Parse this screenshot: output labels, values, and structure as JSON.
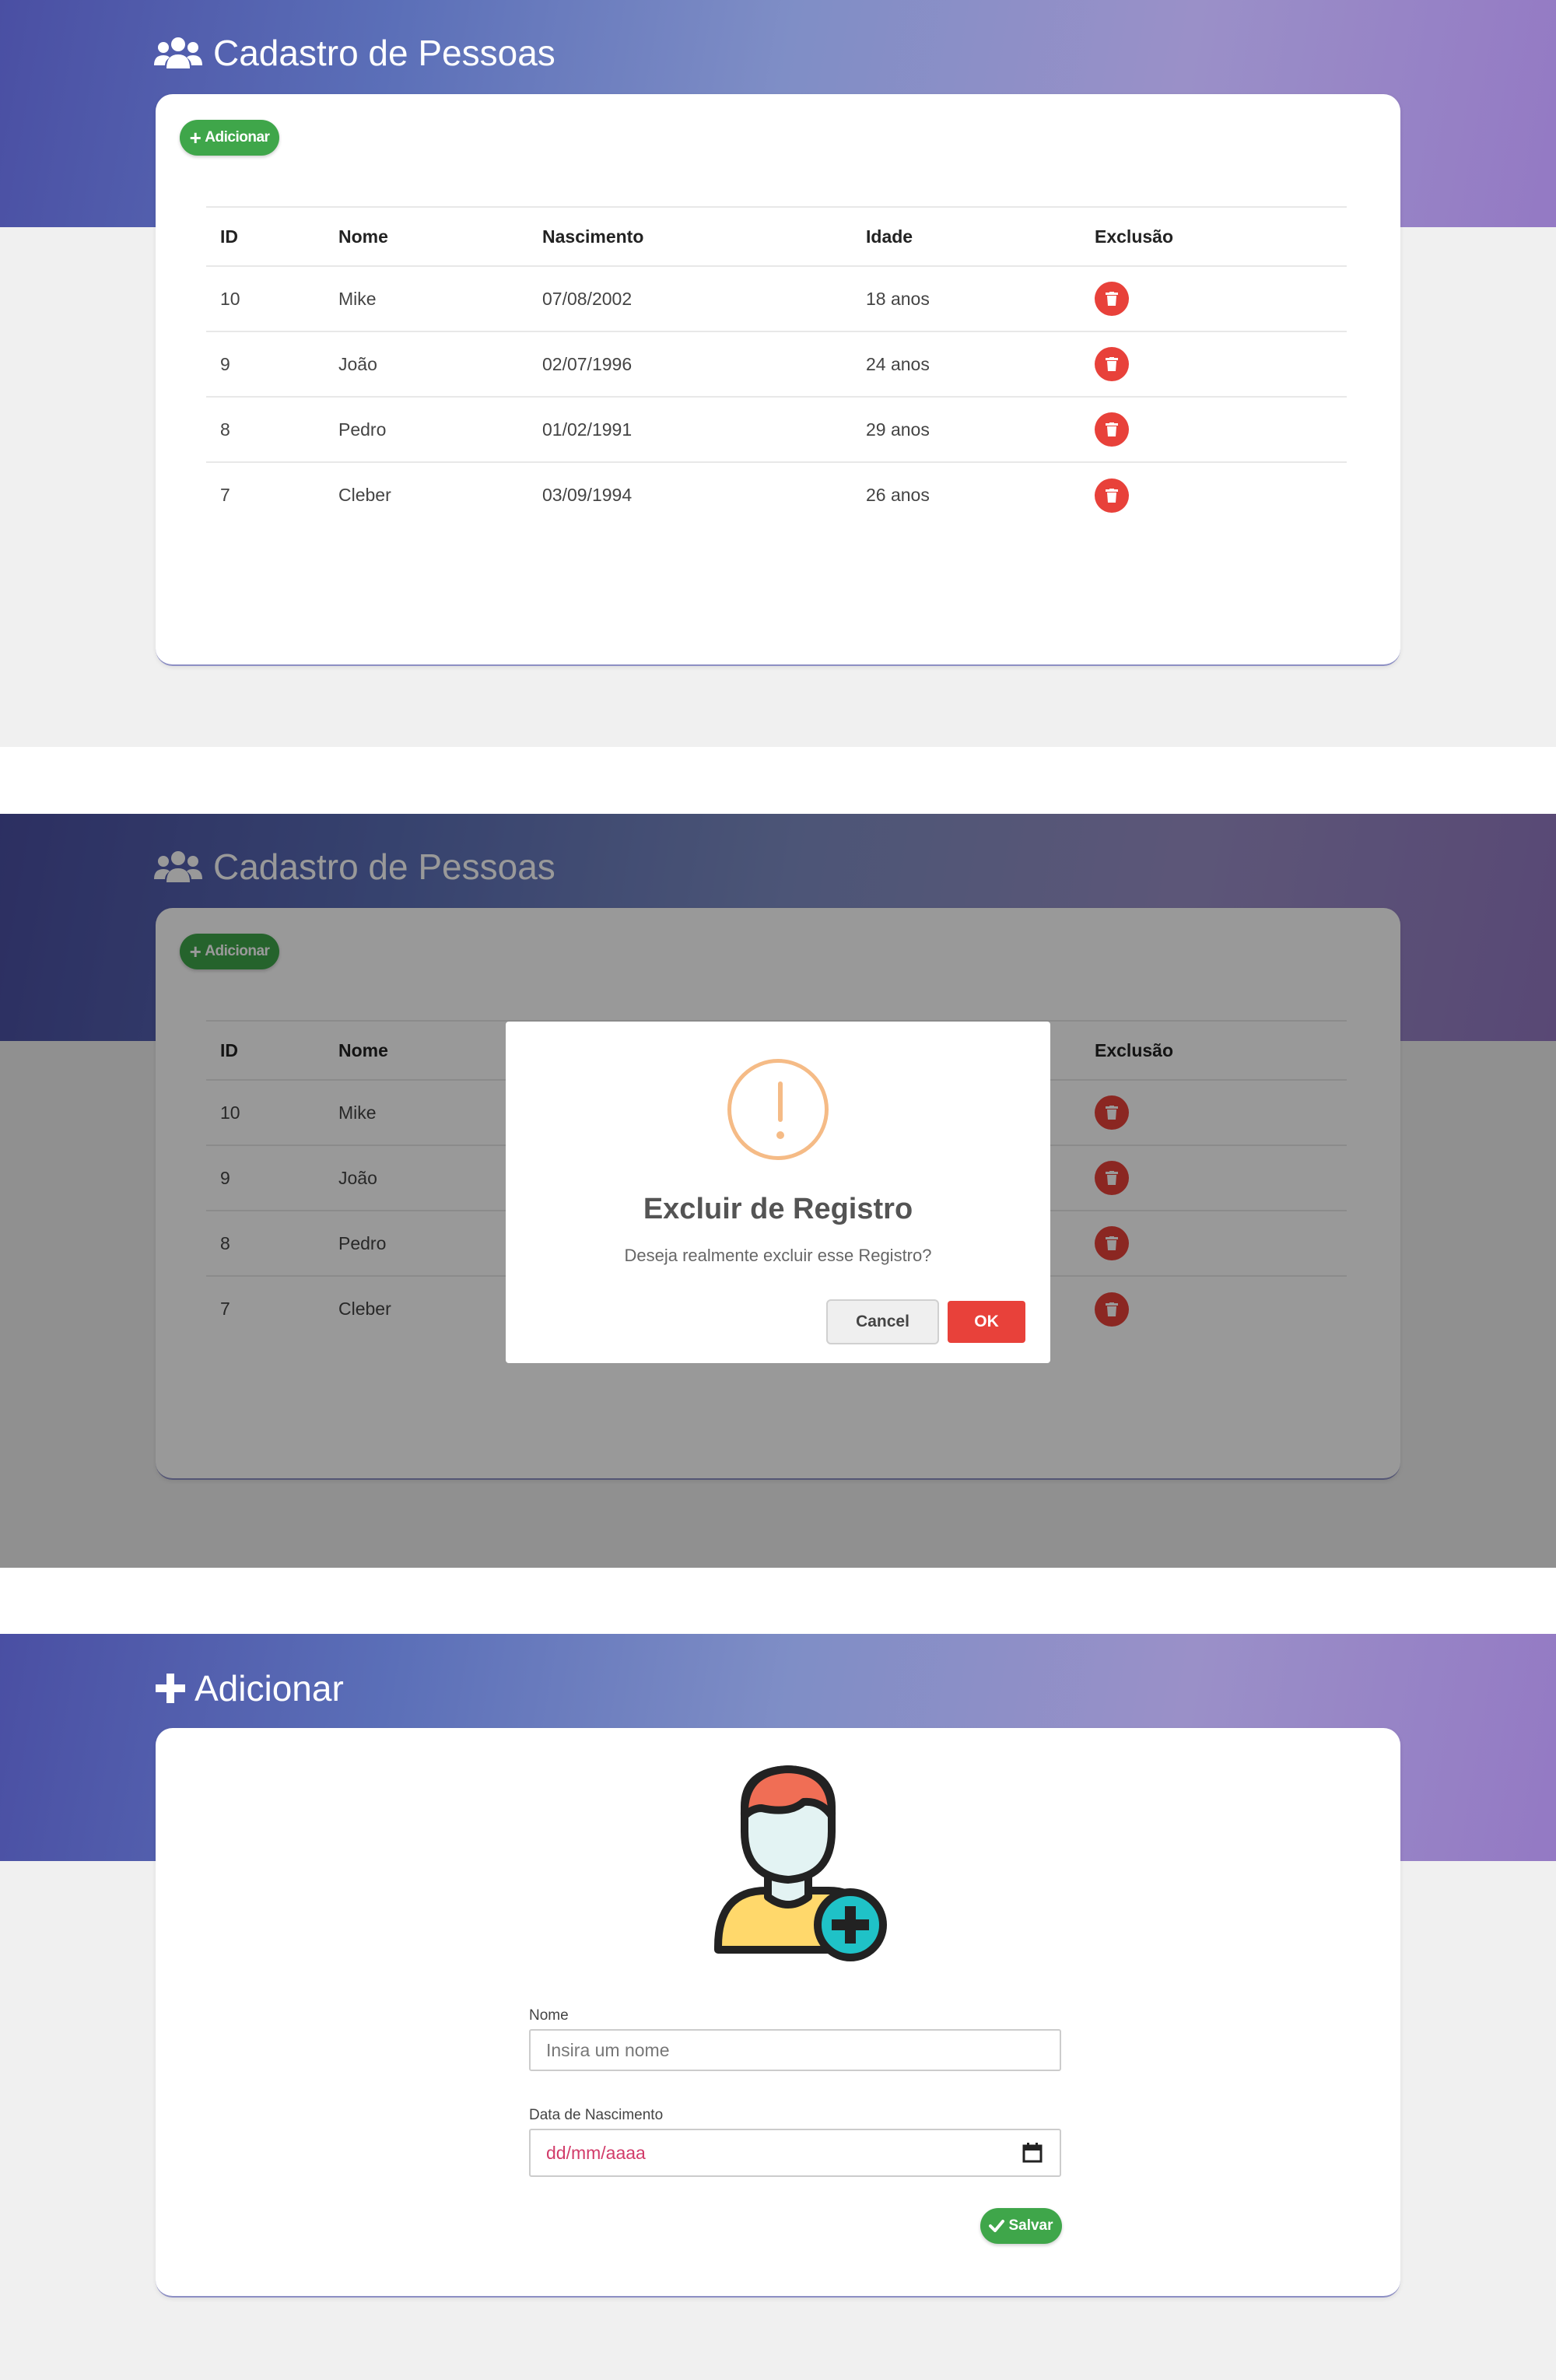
{
  "list_view": {
    "title": "Cadastro de Pessoas",
    "title_icon": "users-icon",
    "add_button": {
      "label": "Adicionar",
      "icon": "plus-icon"
    },
    "table": {
      "headers": [
        "ID",
        "Nome",
        "Nascimento",
        "Idade",
        "Exclusão"
      ],
      "rows": [
        {
          "id": "10",
          "nome": "Mike",
          "nascimento": "07/08/2002",
          "idade": "18 anos",
          "action_icon": "trash-icon"
        },
        {
          "id": "9",
          "nome": "João",
          "nascimento": "02/07/1996",
          "idade": "24 anos",
          "action_icon": "trash-icon"
        },
        {
          "id": "8",
          "nome": "Pedro",
          "nascimento": "01/02/1991",
          "idade": "29 anos",
          "action_icon": "trash-icon"
        },
        {
          "id": "7",
          "nome": "Cleber",
          "nascimento": "03/09/1994",
          "idade": "26 anos",
          "action_icon": "trash-icon"
        }
      ]
    }
  },
  "confirm_dialog": {
    "icon": "warning-icon",
    "title": "Excluir de Registro",
    "message": "Deseja realmente excluir esse Registro?",
    "cancel_label": "Cancel",
    "ok_label": "OK"
  },
  "add_view": {
    "title": "Adicionar",
    "title_icon": "plus-icon",
    "illustration": "add-user-icon",
    "form": {
      "name_label": "Nome",
      "name_placeholder": "Insira um nome",
      "birth_label": "Data de Nascimento",
      "birth_placeholder": "dd/mm/aaaa",
      "save_label": "Salvar",
      "save_icon": "check-icon"
    }
  },
  "colors": {
    "header_gradient_start": "#4a4fa3",
    "header_gradient_end": "#9479c4",
    "success": "#3fa64a",
    "danger": "#e8413a",
    "warning": "#f5bb86",
    "date_text": "#d23c6a"
  }
}
